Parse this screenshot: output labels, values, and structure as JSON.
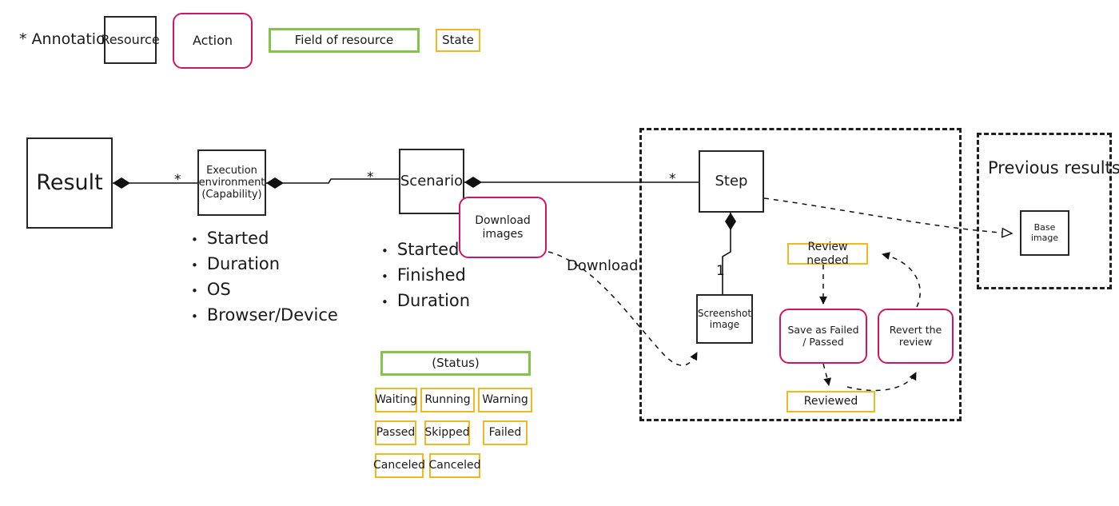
{
  "legend": {
    "annotation_note": "* Annotation",
    "items": [
      {
        "label": "Resource",
        "kind": "resource"
      },
      {
        "label": "Action",
        "kind": "action"
      },
      {
        "label": "Field of resource",
        "kind": "field"
      },
      {
        "label": "State",
        "kind": "state"
      }
    ]
  },
  "colors": {
    "resource_border": "#262626",
    "action_border": "#cf1565",
    "field_border": "#84c44a",
    "state_border": "#f0b91d",
    "line": "#1a1a1a",
    "background": "#ffffff"
  },
  "nodes": {
    "result": {
      "label": "Result"
    },
    "execution_environment": {
      "line1": "Execution",
      "line2": "environment",
      "line3": "(Capability)"
    },
    "scenario": {
      "label": "Scenario"
    },
    "download_images": {
      "line1": "Download",
      "line2": "images"
    },
    "step": {
      "label": "Step"
    },
    "screenshot_image": {
      "line1": "Screenshot",
      "line2": "image"
    },
    "base_image": {
      "label": "Base image"
    },
    "review_needed": {
      "label": "Review needed"
    },
    "save_as_failed_passed": {
      "line1": "Save as Failed",
      "line2": "/ Passed"
    },
    "revert_the_review": {
      "line1": "Revert the",
      "line2": "review"
    },
    "reviewed": {
      "label": "Reviewed"
    }
  },
  "groups": {
    "step_group": {
      "title": ""
    },
    "previous_results": {
      "title": "Previous results"
    }
  },
  "edge_labels": {
    "result_to_env": "*",
    "env_to_scenario": "*",
    "scenario_to_step": "*",
    "step_to_screenshot": "1",
    "download": "Download"
  },
  "field_lists": {
    "execution_environment": [
      "Started",
      "Duration",
      "OS",
      "Browser/Device"
    ],
    "scenario": [
      "Started",
      "Finished",
      "Duration"
    ]
  },
  "status_legend": {
    "header": "(Status)",
    "rows": [
      [
        "Waiting",
        "Running",
        "Warning"
      ],
      [
        "Passed",
        "Skipped",
        "Failed"
      ],
      [
        "Canceled",
        "Canceled"
      ]
    ]
  }
}
